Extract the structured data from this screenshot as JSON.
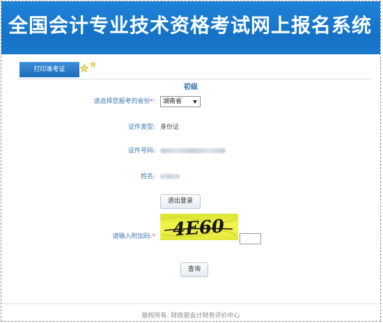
{
  "header": {
    "title": "全国会计专业技术资格考试网上报名系统"
  },
  "tabs": {
    "print_admission_label": "打印准考证"
  },
  "level": {
    "title": "初级"
  },
  "form": {
    "province": {
      "label": "请选择您报考的省份",
      "required_mark": "*",
      "colon": ":",
      "selected": "湖南省"
    },
    "id_type": {
      "label": "证件类型:",
      "value": "身份证"
    },
    "id_number": {
      "label": "证件号码:"
    },
    "name": {
      "label": "姓名:"
    },
    "logout_label": "退出登录",
    "captcha": {
      "label": "请输入附加码:",
      "required_mark": "*",
      "image_text": "4E60"
    },
    "query_label": "查询"
  },
  "footer": {
    "text": "版权所有: 财政部会计财务评价中心"
  },
  "colors": {
    "brand_blue": "#1877cc",
    "label_blue": "#3c78b3",
    "required_red": "#e23a3a",
    "captcha_bg": "#f1f34a"
  }
}
